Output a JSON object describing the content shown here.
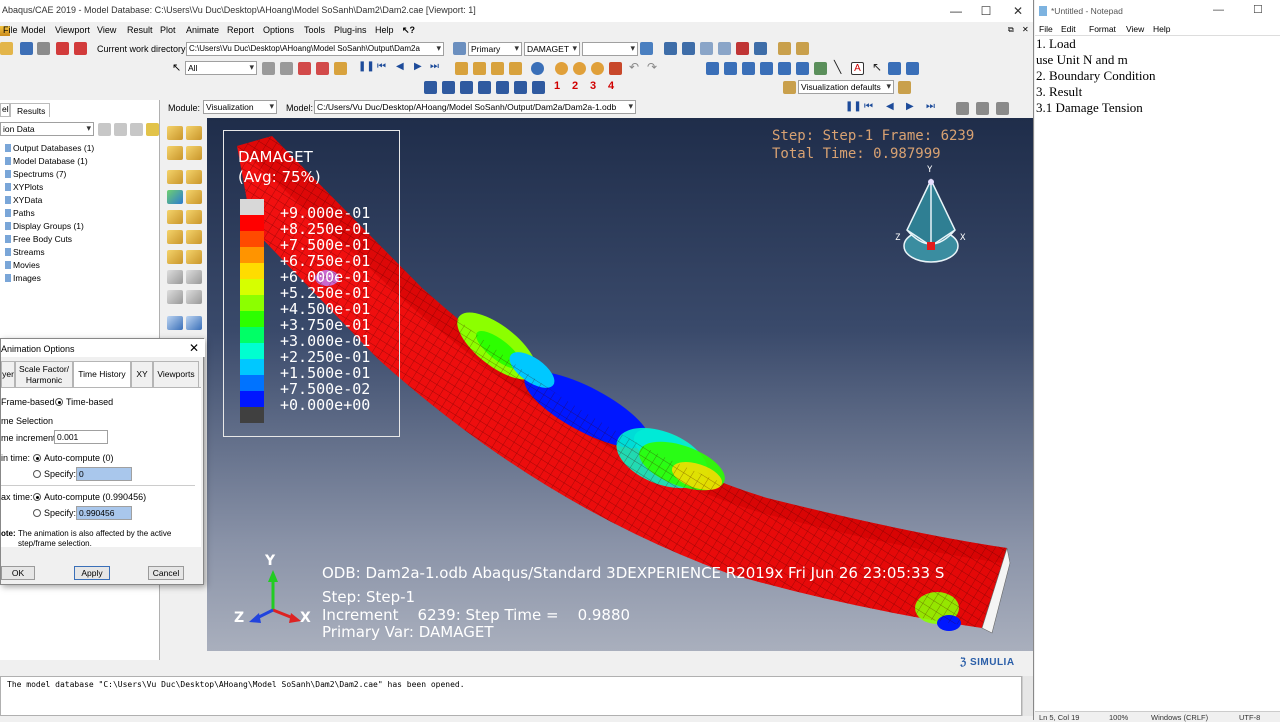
{
  "abaqus": {
    "title": "Abaqus/CAE 2019 - Model Database: C:\\Users\\Vu Duc\\Desktop\\AHoang\\Model SoSanh\\Dam2\\Dam2.cae [Viewport: 1]",
    "menu": [
      "File",
      "Model",
      "Viewport",
      "View",
      "Result",
      "Plot",
      "Animate",
      "Report",
      "Options",
      "Tools",
      "Plug-ins",
      "Help"
    ],
    "toolbar": {
      "cwd_label": "Current work directory:",
      "cwd_value": "C:\\Users\\Vu Duc\\Desktop\\AHoang\\Model SoSanh\\Output\\Dam2a",
      "primary": "Primary",
      "variable": "DAMAGET",
      "selection": "All",
      "render_numbers": [
        "1",
        "2",
        "3",
        "4"
      ],
      "vis_defaults": "Visualization defaults"
    },
    "context": {
      "module_label": "Module:",
      "module_value": "Visualization",
      "model_label": "Model:",
      "model_value": "C:/Users/Vu Duc/Desktop/AHoang/Model SoSanh/Output/Dam2a/Dam2a-1.odb"
    },
    "tree": {
      "tabs": [
        "el",
        "Results"
      ],
      "filter": "ion Data",
      "items": [
        "Output Databases (1)",
        "Model Database (1)",
        "Spectrums (7)",
        "XYPlots",
        "XYData",
        "Paths",
        "Display Groups (1)",
        "Free Body Cuts",
        "Streams",
        "Movies",
        "Images"
      ]
    },
    "viewport": {
      "step_line": "Step: Step-1    Frame: 6239",
      "time_line": "Total Time: 0.987999",
      "legend_title": "DAMAGET",
      "legend_avg": "(Avg: 75%)",
      "legend_labels": [
        "+9.000e-01",
        "+8.250e-01",
        "+7.500e-01",
        "+6.750e-01",
        "+6.000e-01",
        "+5.250e-01",
        "+4.500e-01",
        "+3.750e-01",
        "+3.000e-01",
        "+2.250e-01",
        "+1.500e-01",
        "+7.500e-02",
        "+0.000e+00"
      ],
      "legend_colors": [
        "#d8d8d8",
        "#ff0000",
        "#ff4a00",
        "#ff9400",
        "#ffdc00",
        "#d6ff00",
        "#8cff00",
        "#2dff00",
        "#00ff66",
        "#00ffd0",
        "#00c8ff",
        "#0073ff",
        "#0017ff",
        "#404040"
      ],
      "odb_line": "ODB: Dam2a-1.odb    Abaqus/Standard 3DEXPERIENCE R2019x    Fri Jun 26 23:05:33 S",
      "step_info": "Step: Step-1",
      "increment_info": "Increment    6239: Step Time =    0.9880",
      "primary_var": "Primary Var: DAMAGET",
      "triad": {
        "y": "Y",
        "z": "Z",
        "x": "X"
      },
      "small_triad": {
        "y": "Y",
        "z": "Z",
        "x": "X"
      },
      "brand": "SIMULIA"
    },
    "dialog": {
      "title": "Animation Options",
      "tabs": [
        "yer",
        "Scale Factor/\nHarmonic",
        "Time History",
        "XY",
        "Viewports"
      ],
      "frame_based": "Frame-based",
      "time_based": "Time-based",
      "section": "me Selection",
      "increment_label": "me increment:",
      "increment_value": "0.001",
      "min_label": "in time:",
      "auto_compute_min": "Auto-compute",
      "auto_min_value": "(0)",
      "specify_label": "Specify:",
      "specify_min_value": "0",
      "max_label": "ax time:",
      "auto_compute_max": "Auto-compute",
      "auto_max_value": "(0.990456)",
      "specify_max_value": "0.990456",
      "note_label": "ote:",
      "note_text": "The animation is also affected by the active step/frame selection.",
      "ok": "OK",
      "apply": "Apply",
      "cancel": "Cancel"
    },
    "message": "The model database \"C:\\Users\\Vu Duc\\Desktop\\AHoang\\Model SoSanh\\Dam2\\Dam2.cae\" has been opened."
  },
  "notepad": {
    "title": "*Untitled - Notepad",
    "menu": [
      "File",
      "Edit",
      "Format",
      "View",
      "Help"
    ],
    "lines": [
      "1. Load",
      "use Unit N and m",
      "2. Boundary Condition",
      "3. Result",
      "3.1 Damage Tension"
    ],
    "status": [
      "Ln 5, Col 19",
      "100%",
      "Windows (CRLF)",
      "UTF-8"
    ]
  }
}
